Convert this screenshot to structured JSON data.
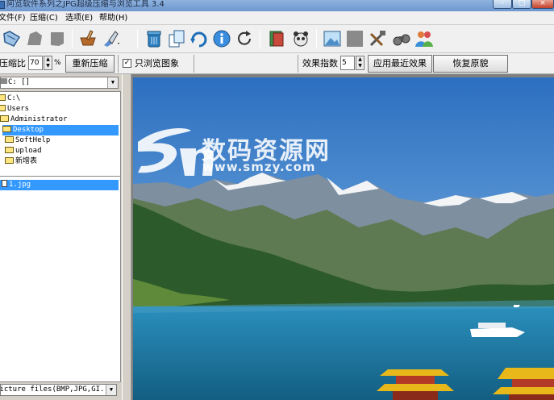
{
  "window": {
    "title": "阿览软件系列之JPG超级压缩与浏览工具 3.4"
  },
  "menu": [
    {
      "label": "文件(F)"
    },
    {
      "label": "压缩(C)"
    },
    {
      "label": "选项(E)"
    },
    {
      "label": "帮助(H)"
    }
  ],
  "toolbar": {
    "icons": [
      "open-folder-icon",
      "disabled-tool-icon",
      "disabled-tool-icon",
      "mortar-compress-icon",
      "brush-dropdown-icon",
      "recycle-bin-icon",
      "copy-icon",
      "undo-arrow-icon",
      "info-icon",
      "refresh-icon",
      "book-icon",
      "panda-icon",
      "picture-icon",
      "disabled-picture-icon",
      "tools-icon",
      "binoculars-icon",
      "users-icon"
    ]
  },
  "options": {
    "ratio_label": "压缩比",
    "ratio_value": "70",
    "ratio_unit": "%",
    "recompress_label": "重新压缩",
    "browse_only_label": "只浏览图象",
    "browse_only_checked": true,
    "effect_label": "效果指数",
    "effect_value": "5",
    "apply_recent_label": "应用最近效果",
    "restore_label": "恢复原貌"
  },
  "leftpane": {
    "drive": "C: []",
    "tree": [
      {
        "label": "C:\\",
        "level": 0,
        "selected": false
      },
      {
        "label": "Users",
        "level": 1,
        "selected": false
      },
      {
        "label": "Administrator",
        "level": 2,
        "selected": false
      },
      {
        "label": "Desktop",
        "level": 3,
        "selected": true
      },
      {
        "label": "SoftHelp",
        "level": 4,
        "selected": false
      },
      {
        "label": "upload",
        "level": 4,
        "selected": false
      },
      {
        "label": "新增表",
        "level": 4,
        "selected": false
      }
    ],
    "files": [
      {
        "name": "1.jpg",
        "selected": true
      }
    ],
    "filter": "Picture files(BMP,JPG,GI..."
  },
  "viewer": {
    "watermark_cn": "数码资源网",
    "watermark_url": "www.smzy.com",
    "colors": {
      "sky": "#4a8fd4",
      "water": "#1f7fa8",
      "mountain_dark": "#2d5a2a",
      "snow": "#f2f4f6",
      "pavilion": "#e8b81a"
    }
  }
}
